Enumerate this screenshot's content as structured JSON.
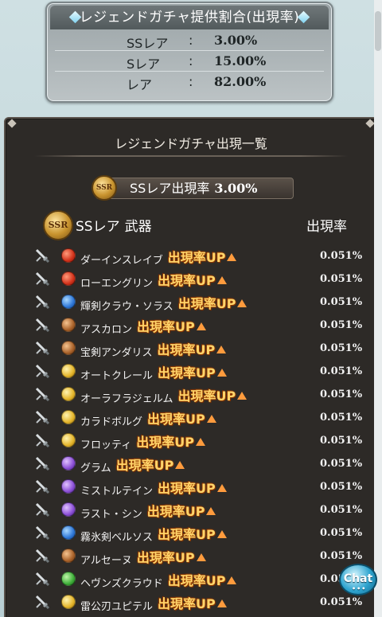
{
  "rate_panel": {
    "title": "レジェンドガチャ提供割合(出現率)",
    "rows": [
      {
        "label": "SSレア",
        "colon": ":",
        "value": "3.00%"
      },
      {
        "label": "Sレア",
        "colon": ":",
        "value": "15.00%"
      },
      {
        "label": "レア",
        "colon": ":",
        "value": "82.00%"
      }
    ]
  },
  "list": {
    "title": "レジェンドガチャ出現一覧",
    "banner_label": "SSレア出現率",
    "banner_value": "3.00%",
    "badge_text": "SSR",
    "section_label": "SSレア",
    "section_type": "武器",
    "rate_header": "出現率",
    "up_label": "出現率UP",
    "items": [
      {
        "name": "ダーインスレイブ",
        "element": "fire",
        "rate": "0.051%"
      },
      {
        "name": "ローエングリン",
        "element": "fire",
        "rate": "0.051%"
      },
      {
        "name": "輝剣クラウ・ソラス",
        "element": "water",
        "rate": "0.051%"
      },
      {
        "name": "アスカロン",
        "element": "earth",
        "rate": "0.051%"
      },
      {
        "name": "宝剣アンダリス",
        "element": "earth",
        "rate": "0.051%"
      },
      {
        "name": "オートクレール",
        "element": "light",
        "rate": "0.051%"
      },
      {
        "name": "オーラフラジェルム",
        "element": "light",
        "rate": "0.051%"
      },
      {
        "name": "カラドボルグ",
        "element": "light",
        "rate": "0.051%"
      },
      {
        "name": "フロッティ",
        "element": "light",
        "rate": "0.051%"
      },
      {
        "name": "グラム",
        "element": "dark",
        "rate": "0.051%"
      },
      {
        "name": "ミストルテイン",
        "element": "dark",
        "rate": "0.051%"
      },
      {
        "name": "ラスト・シン",
        "element": "dark",
        "rate": "0.051%"
      },
      {
        "name": "霧氷剣ベルソス",
        "element": "water",
        "rate": "0.051%"
      },
      {
        "name": "アルセーヌ",
        "element": "earth",
        "rate": "0.051%"
      },
      {
        "name": "ヘヴンズクラウド",
        "element": "wind",
        "rate": "0.051"
      },
      {
        "name": "雷公刃ユピテル",
        "element": "light",
        "rate": "0.051%"
      }
    ]
  },
  "chat_button": {
    "label": "Chat",
    "dots": "•••"
  }
}
